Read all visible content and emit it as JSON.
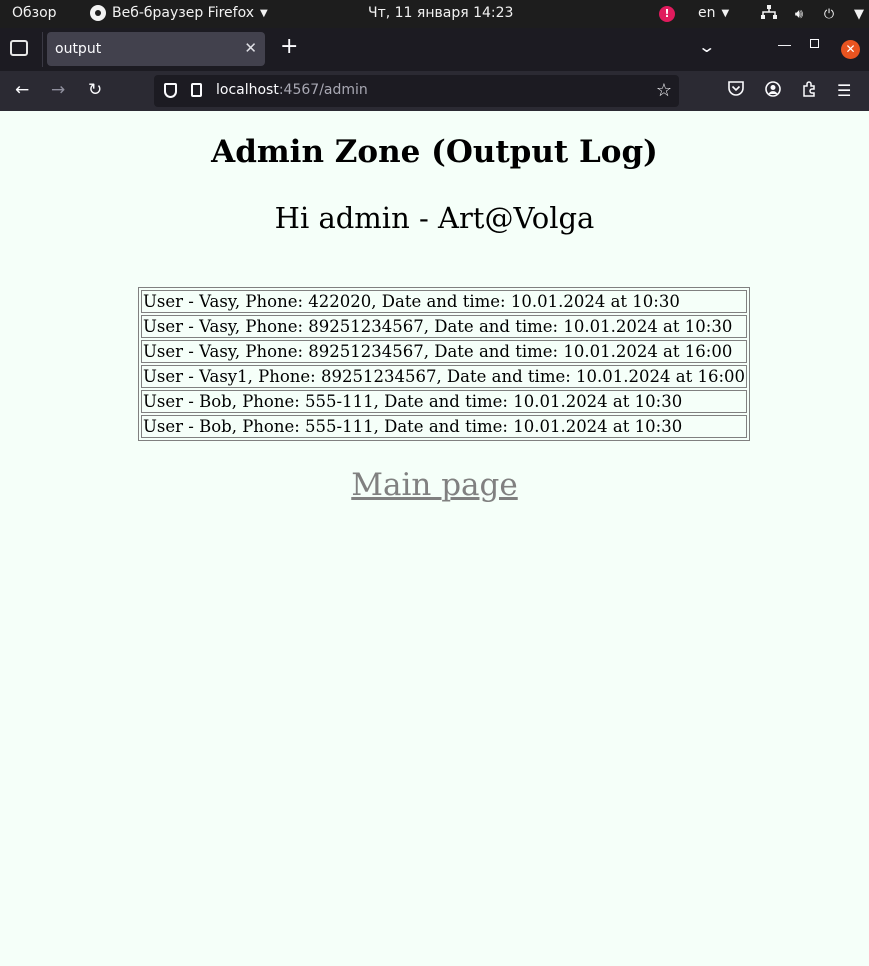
{
  "system_bar": {
    "overview": "Обзор",
    "app_name": "Веб-браузер Firefox",
    "clock": "Чт, 11 января  14:23",
    "alert": "!",
    "language": "en"
  },
  "browser": {
    "tab_title": "output",
    "url_host": "localhost",
    "url_rest": ":4567/admin"
  },
  "page": {
    "heading": "Admin Zone (Output Log)",
    "greeting": "Hi admin - Art@Volga",
    "log_rows": [
      "User - Vasy, Phone: 422020, Date and time: 10.01.2024 at 10:30",
      "User - Vasy, Phone: 89251234567, Date and time: 10.01.2024 at 10:30",
      "User - Vasy, Phone: 89251234567, Date and time: 10.01.2024 at 16:00",
      "User - Vasy1, Phone: 89251234567, Date and time: 10.01.2024 at 16:00",
      "User - Bob, Phone: 555-111, Date and time: 10.01.2024 at 10:30",
      "User - Bob, Phone: 555-111, Date and time: 10.01.2024 at 10:30"
    ],
    "main_link": "Main page"
  }
}
